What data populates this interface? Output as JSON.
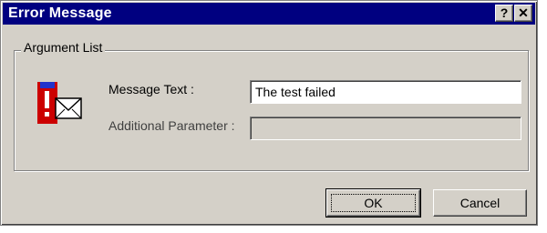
{
  "window": {
    "title": "Error Message",
    "help_glyph": "?",
    "close_glyph": "✕"
  },
  "group": {
    "legend": "Argument List",
    "icon": "error-message-icon"
  },
  "fields": {
    "message_label": "Message Text :",
    "message_value": "The test failed",
    "param_label": "Additional Parameter :",
    "param_value": ""
  },
  "buttons": {
    "ok_label": "OK",
    "cancel_label": "Cancel"
  },
  "colors": {
    "title_bar": "#000080",
    "face": "#d4d0c8",
    "icon_red": "#cc0000",
    "icon_blue": "#2233cc"
  }
}
